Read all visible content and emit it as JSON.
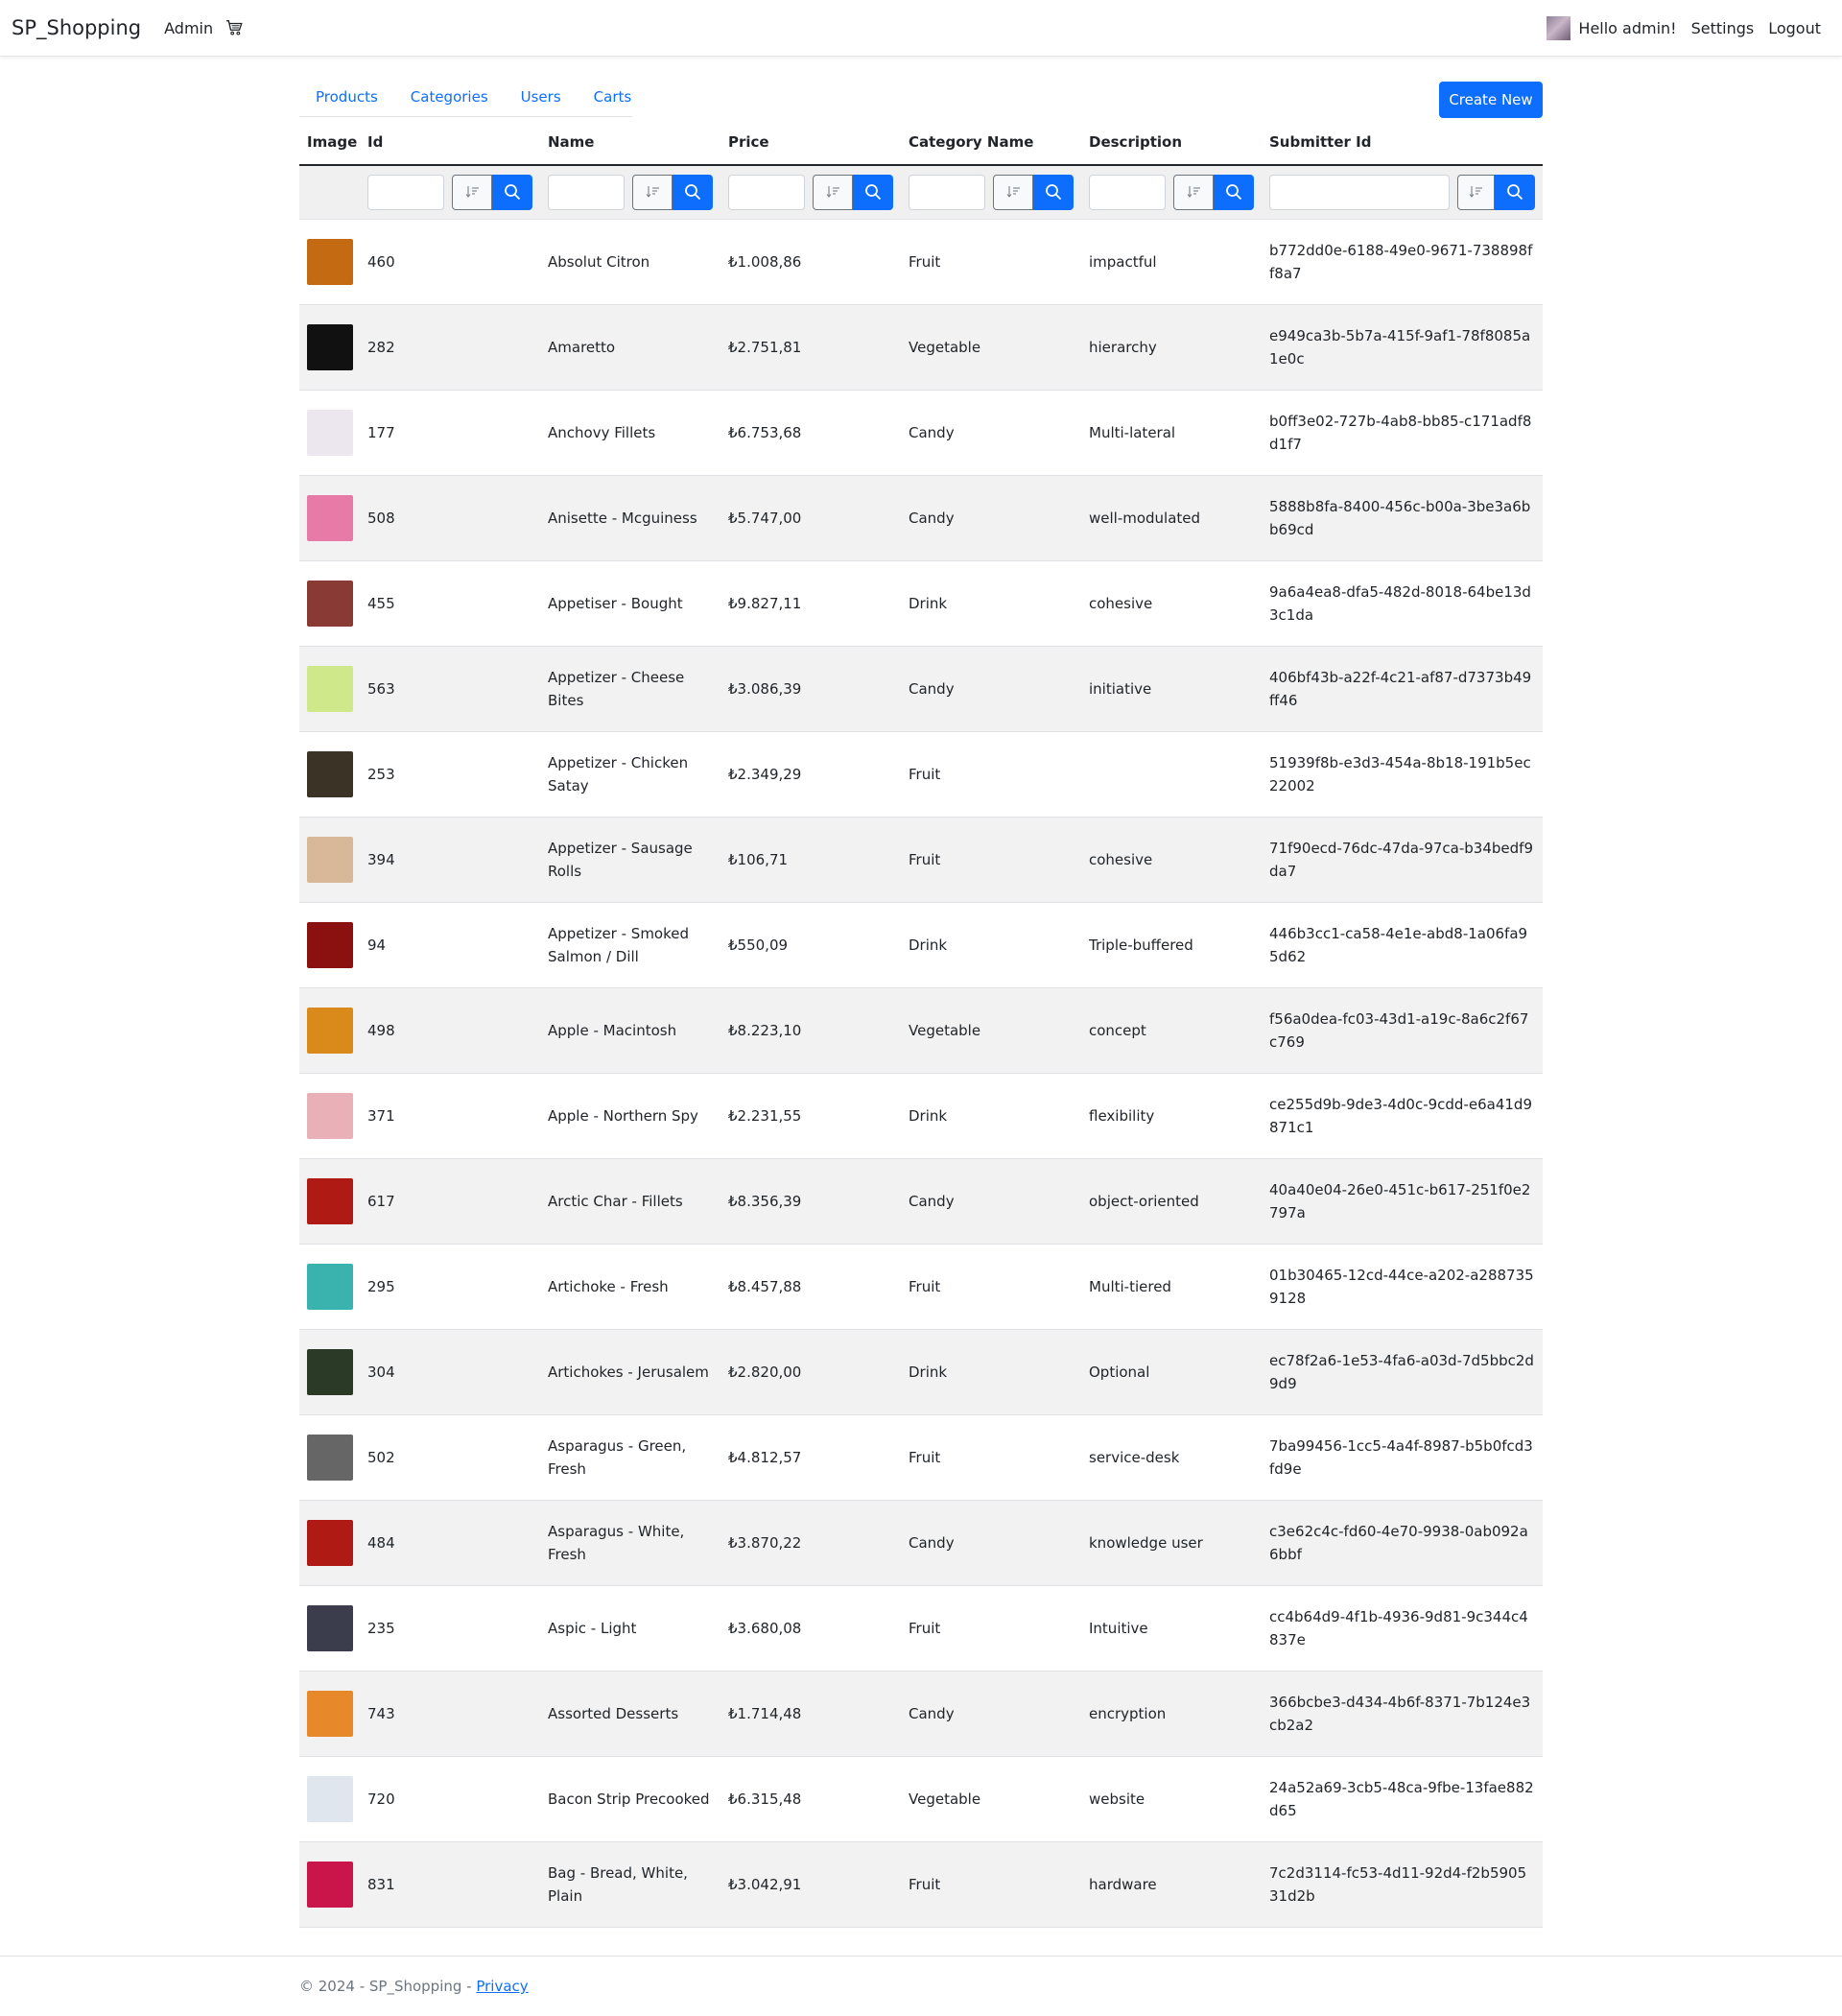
{
  "navbar": {
    "brand": "SP_Shopping",
    "admin_link": "Admin",
    "greeting": "Hello admin!",
    "settings": "Settings",
    "logout": "Logout"
  },
  "tabs": [
    {
      "label": "Products"
    },
    {
      "label": "Categories"
    },
    {
      "label": "Users"
    },
    {
      "label": "Carts"
    }
  ],
  "create_button": "Create New",
  "table": {
    "headers": [
      "Image",
      "Id",
      "Name",
      "Price",
      "Category Name",
      "Description",
      "Submitter Id"
    ],
    "rows": [
      {
        "id": "460",
        "name": "Absolut Citron",
        "price": "₺1.008,86",
        "category": "Fruit",
        "description": "impactful",
        "submitter": "b772dd0e-6188-49e0-9671-738898ff8a7",
        "img": "#c46a12"
      },
      {
        "id": "282",
        "name": "Amaretto",
        "price": "₺2.751,81",
        "category": "Vegetable",
        "description": "hierarchy",
        "submitter": "e949ca3b-5b7a-415f-9af1-78f8085a1e0c",
        "img": "#111111"
      },
      {
        "id": "177",
        "name": "Anchovy Fillets",
        "price": "₺6.753,68",
        "category": "Candy",
        "description": "Multi-lateral",
        "submitter": "b0ff3e02-727b-4ab8-bb85-c171adf8d1f7",
        "img": "#ece6ef"
      },
      {
        "id": "508",
        "name": "Anisette - Mcguiness",
        "price": "₺5.747,00",
        "category": "Candy",
        "description": "well-modulated",
        "submitter": "5888b8fa-8400-456c-b00a-3be3a6bb69cd",
        "img": "#e87aa8"
      },
      {
        "id": "455",
        "name": "Appetiser - Bought",
        "price": "₺9.827,11",
        "category": "Drink",
        "description": "cohesive",
        "submitter": "9a6a4ea8-dfa5-482d-8018-64be13d3c1da",
        "img": "#8a3a35"
      },
      {
        "id": "563",
        "name": "Appetizer - Cheese Bites",
        "price": "₺3.086,39",
        "category": "Candy",
        "description": "initiative",
        "submitter": "406bf43b-a22f-4c21-af87-d7373b49ff46",
        "img": "#cfe88a"
      },
      {
        "id": "253",
        "name": "Appetizer - Chicken Satay",
        "price": "₺2.349,29",
        "category": "Fruit",
        "description": "",
        "submitter": "51939f8b-e3d3-454a-8b18-191b5ec22002",
        "img": "#3a3326"
      },
      {
        "id": "394",
        "name": "Appetizer - Sausage Rolls",
        "price": "₺106,71",
        "category": "Fruit",
        "description": "cohesive",
        "submitter": "71f90ecd-76dc-47da-97ca-b34bedf9da7",
        "img": "#d9b89a"
      },
      {
        "id": "94",
        "name": "Appetizer - Smoked Salmon / Dill",
        "price": "₺550,09",
        "category": "Drink",
        "description": "Triple-buffered",
        "submitter": "446b3cc1-ca58-4e1e-abd8-1a06fa95d62",
        "img": "#8b1010"
      },
      {
        "id": "498",
        "name": "Apple - Macintosh",
        "price": "₺8.223,10",
        "category": "Vegetable",
        "description": "concept",
        "submitter": "f56a0dea-fc03-43d1-a19c-8a6c2f67c769",
        "img": "#d98a1a"
      },
      {
        "id": "371",
        "name": "Apple - Northern Spy",
        "price": "₺2.231,55",
        "category": "Drink",
        "description": "flexibility",
        "submitter": "ce255d9b-9de3-4d0c-9cdd-e6a41d9871c1",
        "img": "#e9b0b8"
      },
      {
        "id": "617",
        "name": "Arctic Char - Fillets",
        "price": "₺8.356,39",
        "category": "Candy",
        "description": "object-oriented",
        "submitter": "40a40e04-26e0-451c-b617-251f0e2797a",
        "img": "#b01a14"
      },
      {
        "id": "295",
        "name": "Artichoke - Fresh",
        "price": "₺8.457,88",
        "category": "Fruit",
        "description": "Multi-tiered",
        "submitter": "01b30465-12cd-44ce-a202-a2887359128",
        "img": "#3ab3ae"
      },
      {
        "id": "304",
        "name": "Artichokes - Jerusalem",
        "price": "₺2.820,00",
        "category": "Drink",
        "description": "Optional",
        "submitter": "ec78f2a6-1e53-4fa6-a03d-7d5bbc2d9d9",
        "img": "#2a3a26"
      },
      {
        "id": "502",
        "name": "Asparagus - Green, Fresh",
        "price": "₺4.812,57",
        "category": "Fruit",
        "description": "service-desk",
        "submitter": "7ba99456-1cc5-4a4f-8987-b5b0fcd3fd9e",
        "img": "#666666"
      },
      {
        "id": "484",
        "name": "Asparagus - White, Fresh",
        "price": "₺3.870,22",
        "category": "Candy",
        "description": "knowledge user",
        "submitter": "c3e62c4c-fd60-4e70-9938-0ab092a6bbf",
        "img": "#b01a14"
      },
      {
        "id": "235",
        "name": "Aspic - Light",
        "price": "₺3.680,08",
        "category": "Fruit",
        "description": "Intuitive",
        "submitter": "cc4b64d9-4f1b-4936-9d81-9c344c4837e",
        "img": "#3b3d4c"
      },
      {
        "id": "743",
        "name": "Assorted Desserts",
        "price": "₺1.714,48",
        "category": "Candy",
        "description": "encryption",
        "submitter": "366bcbe3-d434-4b6f-8371-7b124e3cb2a2",
        "img": "#e7892a"
      },
      {
        "id": "720",
        "name": "Bacon Strip Precooked",
        "price": "₺6.315,48",
        "category": "Vegetable",
        "description": "website",
        "submitter": "24a52a69-3cb5-48ca-9fbe-13fae882d65",
        "img": "#dfe6ee"
      },
      {
        "id": "831",
        "name": "Bag - Bread, White, Plain",
        "price": "₺3.042,91",
        "category": "Fruit",
        "description": "hardware",
        "submitter": "7c2d3114-fc53-4d11-92d4-f2b590531d2b",
        "img": "#c9154a"
      }
    ]
  },
  "footer": {
    "text": "© 2024 - SP_Shopping - ",
    "privacy": "Privacy"
  }
}
